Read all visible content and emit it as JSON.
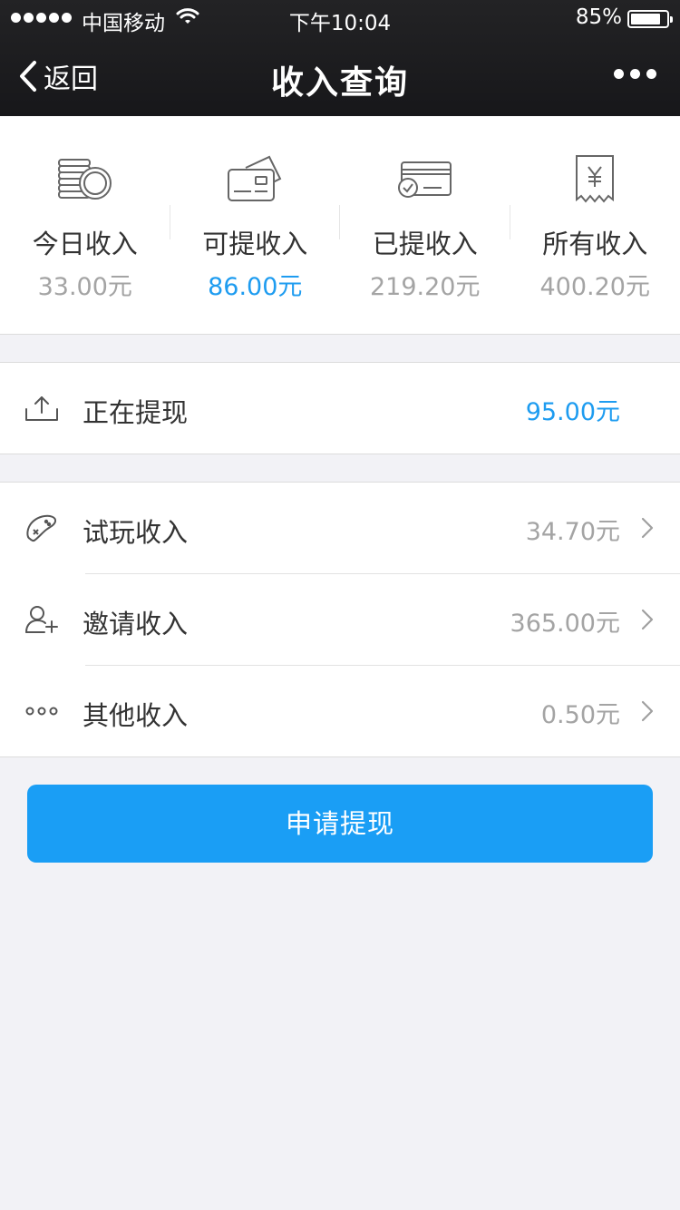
{
  "status_bar": {
    "carrier": "中国移动",
    "time": "下午10:04",
    "battery": "85%",
    "battery_level": 0.85
  },
  "nav": {
    "back_label": "返回",
    "title": "收入查询"
  },
  "summary": [
    {
      "label": "今日收入",
      "value": "33.00元",
      "icon": "coins-icon"
    },
    {
      "label": "可提收入",
      "value": "86.00元",
      "icon": "cards-icon",
      "highlight": true
    },
    {
      "label": "已提收入",
      "value": "219.20元",
      "icon": "card-check-icon"
    },
    {
      "label": "所有收入",
      "value": "400.20元",
      "icon": "receipt-yen-icon"
    }
  ],
  "withdrawing": {
    "label": "正在提现",
    "value": "95.00元",
    "icon": "upload-icon"
  },
  "income_rows": [
    {
      "label": "试玩收入",
      "value": "34.70元",
      "icon": "gamepad-icon"
    },
    {
      "label": "邀请收入",
      "value": "365.00元",
      "icon": "add-user-icon"
    },
    {
      "label": "其他收入",
      "value": "0.50元",
      "icon": "more-dots-icon"
    }
  ],
  "apply_button": "申请提现",
  "colors": {
    "accent": "#1e9cf0",
    "button": "#1a9ef5",
    "navbar": "#1c1c1e",
    "background": "#f2f2f6"
  }
}
